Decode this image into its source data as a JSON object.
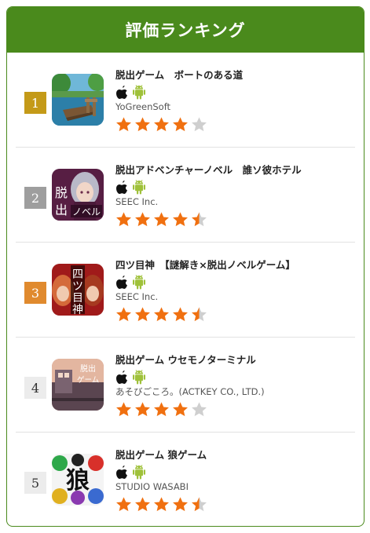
{
  "header": {
    "title": "評価ランキング"
  },
  "colors": {
    "brand_green": "#4a8a1c",
    "star_filled": "#f07010",
    "star_empty": "#cfcfcf",
    "android_green": "#9fc13a",
    "rank_gold": "#c49a18",
    "rank_silver": "#9e9e9e",
    "rank_bronze": "#e08a2e"
  },
  "ranking": [
    {
      "rank": "1",
      "title": "脱出ゲーム　ボートのある道",
      "developer": "YoGreenSoft",
      "rating": 4,
      "platforms": [
        "apple-icon",
        "android-icon"
      ]
    },
    {
      "rank": "2",
      "title": "脱出アドベンチャーノベル　誰ソ彼ホテル",
      "developer": "SEEC Inc.",
      "rating": 4.5,
      "platforms": [
        "apple-icon",
        "android-icon"
      ]
    },
    {
      "rank": "3",
      "title": "四ツ目神　【謎解き×脱出ノベルゲーム】",
      "developer": "SEEC Inc.",
      "rating": 4.5,
      "platforms": [
        "apple-icon",
        "android-icon"
      ]
    },
    {
      "rank": "4",
      "title": "脱出ゲーム ウセモノターミナル",
      "developer": "あそびごころ。(ACTKEY CO., LTD.)",
      "rating": 4,
      "platforms": [
        "apple-icon",
        "android-icon"
      ]
    },
    {
      "rank": "5",
      "title": "脱出ゲーム 狼ゲーム",
      "developer": "STUDIO WASABI",
      "rating": 4.5,
      "platforms": [
        "apple-icon",
        "android-icon"
      ]
    }
  ],
  "thumb_text": {
    "item2": {
      "line1": "脱",
      "line2": "出",
      "line3": "ノベル"
    },
    "item3": {
      "line1": "四",
      "line2": "ツ",
      "line3": "目",
      "line4": "神"
    },
    "item4": {
      "line1": "脱出",
      "line2": "ゲーム"
    },
    "item5": {
      "line1": "狼"
    }
  }
}
